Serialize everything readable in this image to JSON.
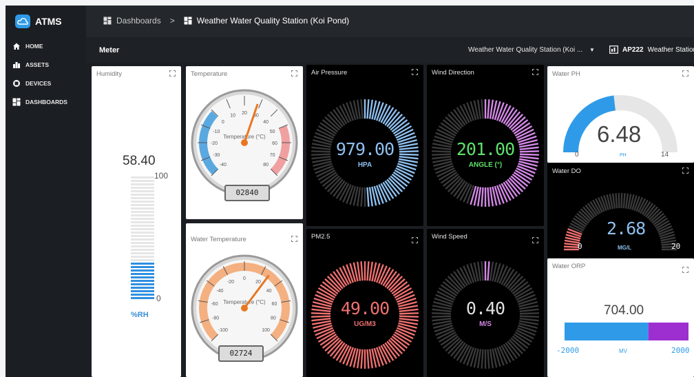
{
  "app": {
    "name": "ATMS"
  },
  "sidebar": {
    "items": [
      {
        "label": "HOME",
        "icon": "home-icon"
      },
      {
        "label": "ASSETS",
        "icon": "assets-icon"
      },
      {
        "label": "DEVICES",
        "icon": "devices-icon"
      },
      {
        "label": "DASHBOARDS",
        "icon": "dashboards-icon"
      }
    ]
  },
  "breadcrumb": {
    "root": "Dashboards",
    "separator": ">",
    "current": "Weather Water Quality Station (Koi Pond)"
  },
  "toolbar": {
    "section_title": "Meter",
    "station_select": "Weather Water Quality Station (Koi ...",
    "device_code": "AP222",
    "device_name": "Weather Station"
  },
  "colors": {
    "accent": "#2f9be8",
    "dark_panel": "#000000",
    "sidebar": "#1b1e22",
    "humidity_bar": "#2f8fe0",
    "air_pressure": "#8ec0f0",
    "wind_direction": "#d588e8",
    "pm25": "#f07070",
    "wind_speed": "#d588e8",
    "water_do": "#f07070",
    "orp_low": "#2f9be8",
    "orp_high": "#9d2fd0"
  },
  "widgets": {
    "humidity": {
      "title": "Humidity",
      "value": "58.40",
      "max": "100",
      "min": "0",
      "unit": "%RH",
      "level": 0.584
    },
    "temperature": {
      "title": "Temperature",
      "label": "Temperature (°C)",
      "ticks": [
        "-40",
        "-30",
        "-20",
        "-10",
        "0",
        "10",
        "20",
        "30",
        "40",
        "50",
        "60",
        "70",
        "80"
      ],
      "needle": 28.4,
      "odometer": "02840"
    },
    "water_temperature": {
      "title": "Water Temperature",
      "label": "Temperature (°C)",
      "ticks": [
        "-100",
        "-80",
        "-60",
        "-40",
        "-20",
        "0",
        "20",
        "40",
        "60",
        "80",
        "100"
      ],
      "needle": 27.24,
      "odometer": "02724"
    },
    "air_pressure": {
      "title": "Air Pressure",
      "value": "979.00",
      "unit": "HPA",
      "fill": 0.5
    },
    "wind_direction": {
      "title": "Wind Direction",
      "value": "201.00",
      "unit": "ANGLE (°)",
      "fill": 0.558
    },
    "pm25": {
      "title": "PM2.5",
      "value": "49.00",
      "unit": "UG/M3",
      "fill": 1.0
    },
    "wind_speed": {
      "title": "Wind Speed",
      "value": "0.40",
      "unit": "M/S",
      "fill": 0.02
    },
    "water_ph": {
      "title": "Water PH",
      "value": "6.48",
      "unit": "PH",
      "min": "0",
      "max": "14",
      "fraction": 0.463
    },
    "water_do": {
      "title": "Water DO",
      "value": "2.68",
      "unit": "MG/L",
      "min": "0",
      "max": "20",
      "fraction": 0.134
    },
    "water_orp": {
      "title": "Water ORP",
      "value": "704.00",
      "unit": "MV",
      "min": "-2000",
      "max": "2000",
      "fraction": 0.676
    }
  }
}
